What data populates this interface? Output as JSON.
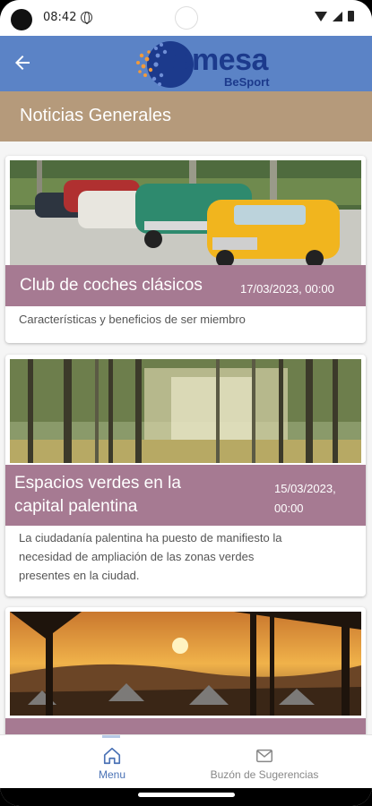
{
  "status_bar": {
    "time": "08:42"
  },
  "header": {
    "logo_text": "Omesa",
    "logo_subtext": "BeSport"
  },
  "section": {
    "title": "Noticias Generales"
  },
  "news": [
    {
      "title": "Club de coches clásicos",
      "date": "17/03/2023, 00:00",
      "description": "Características y beneficios de ser miembro",
      "image": "classic-cars-photo"
    },
    {
      "title_line1": "Espacios verdes en la",
      "title_line2": "capital palentina",
      "date_line1": "15/03/2023,",
      "date_line2": "00:00",
      "description_line1": "La ciudadanía palentina ha puesto de manifiesto la",
      "description_line2": "necesidad de ampliación de las zonas verdes",
      "description_line3": "presentes en la ciudad.",
      "image": "forest-photo"
    },
    {
      "image": "sunset-camping-photo"
    }
  ],
  "bottom_nav": {
    "items": [
      {
        "label": "Menu",
        "icon": "home-icon",
        "active": true
      },
      {
        "label": "Buzón de Sugerencias",
        "icon": "mail-icon",
        "active": false
      }
    ]
  },
  "colors": {
    "header": "#5b83c6",
    "section_bar": "#b59a7b",
    "card_title_bar": "#a67a92",
    "accent": "#4a72b5"
  }
}
